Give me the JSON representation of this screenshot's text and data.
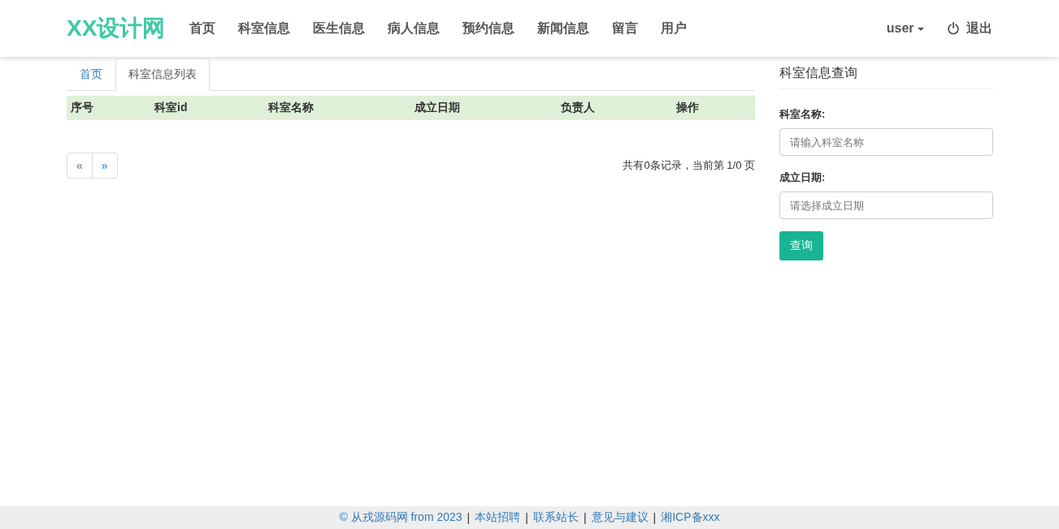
{
  "navbar": {
    "brand": "XX设计网",
    "items": [
      "首页",
      "科室信息",
      "医生信息",
      "病人信息",
      "预约信息",
      "新闻信息",
      "留言",
      "用户"
    ],
    "user": "user",
    "logout": "退出"
  },
  "tabs": [
    {
      "label": "首页",
      "selected": false
    },
    {
      "label": "科室信息列表",
      "selected": true
    }
  ],
  "table": {
    "columns": [
      "序号",
      "科室id",
      "科室名称",
      "成立日期",
      "负责人",
      "操作"
    ]
  },
  "pagination": {
    "prev": "«",
    "next": "»",
    "summary": "共有0条记录，当前第 1/0 页"
  },
  "search_panel": {
    "title": "科室信息查询",
    "fields": [
      {
        "label": "科室名称:",
        "placeholder": "请输入科室名称"
      },
      {
        "label": "成立日期:",
        "placeholder": "请选择成立日期"
      }
    ],
    "button": "查询"
  },
  "footer": {
    "separator": "|",
    "links": [
      "© 从戎源码网 from 2023",
      "本站招聘",
      "联系站长",
      "意见与建议",
      "湘ICP备xxx"
    ]
  }
}
